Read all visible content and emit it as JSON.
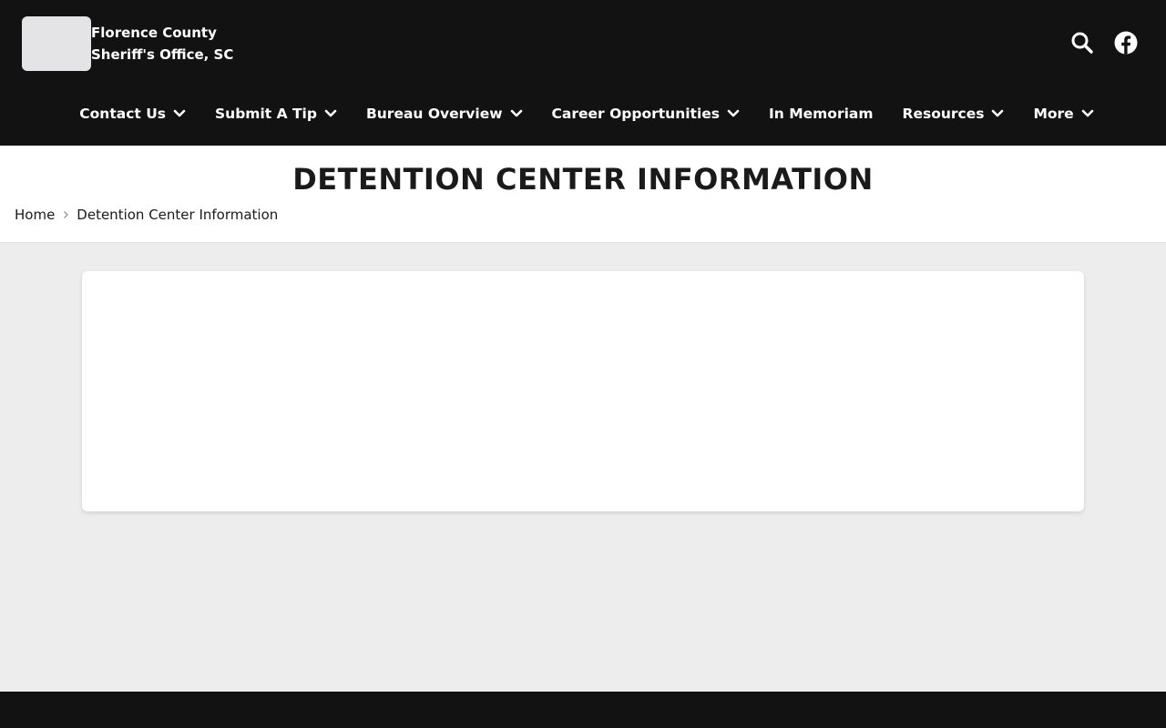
{
  "header": {
    "site_name_line1": "Florence County",
    "site_name_line2": "Sheriff's Office, SC",
    "icons": [
      "search-icon",
      "facebook-icon"
    ]
  },
  "nav": {
    "items": [
      {
        "label": "Contact Us",
        "dropdown": true
      },
      {
        "label": "Submit A Tip",
        "dropdown": true
      },
      {
        "label": "Bureau Overview",
        "dropdown": true
      },
      {
        "label": "Career Opportunities",
        "dropdown": true
      },
      {
        "label": "In Memoriam",
        "dropdown": false
      },
      {
        "label": "Resources",
        "dropdown": true
      },
      {
        "label": "More",
        "dropdown": true
      }
    ]
  },
  "page": {
    "title": "DETENTION CENTER INFORMATION",
    "breadcrumb": {
      "home": "Home",
      "current": "Detention Center Information"
    }
  },
  "colors": {
    "header_bg": "#121212",
    "page_bg": "#ededed",
    "card_bg": "#ffffff",
    "text_dark": "#1a1a1a"
  }
}
